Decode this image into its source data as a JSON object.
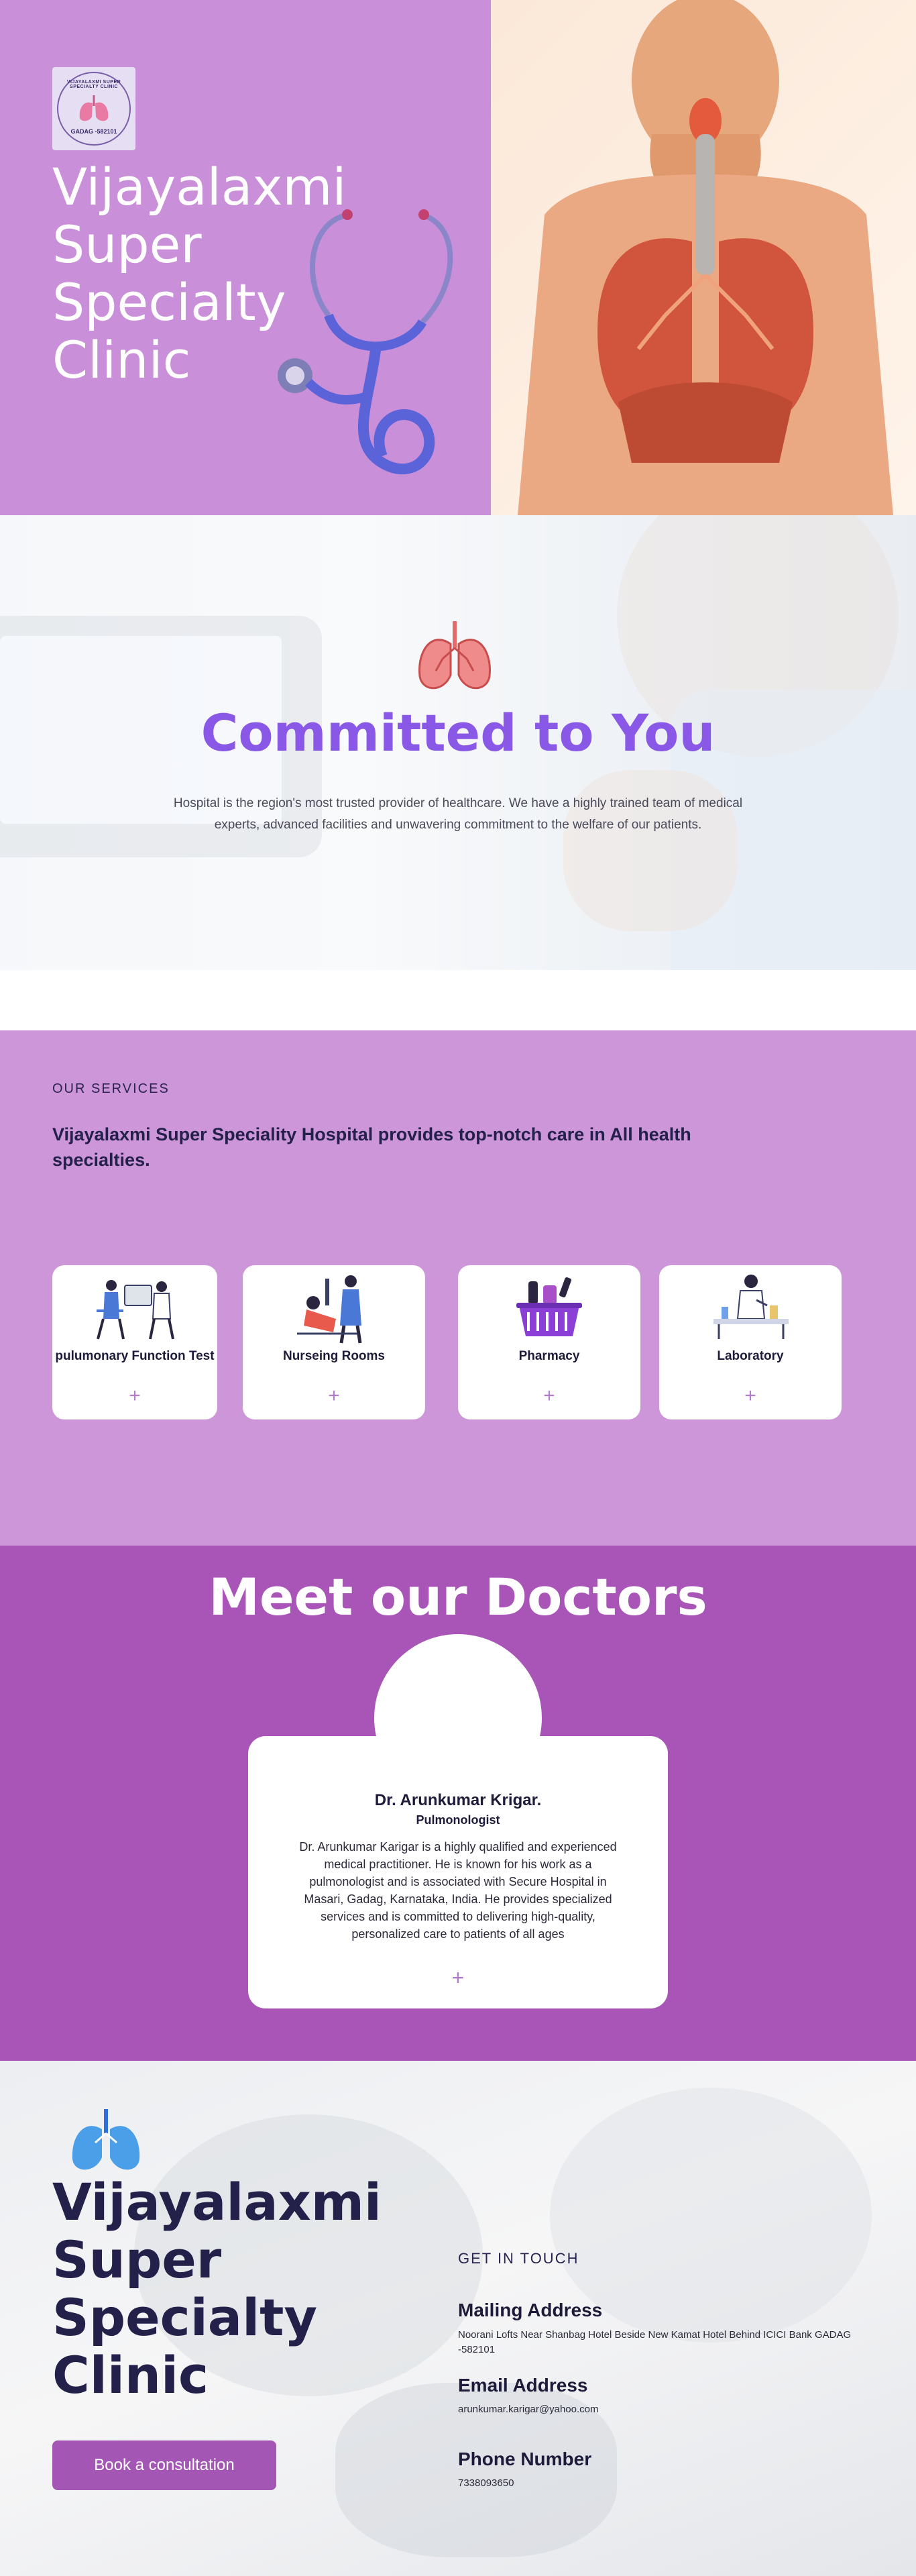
{
  "hero": {
    "logo_top_text": "VIJAYALAXMI SUPER SPECIALTY CLINIC",
    "logo_bottom_text": "GADAG -582101",
    "title": "Vijayalaxmi Super Specialty Clinic"
  },
  "committed": {
    "title": "Committed to You",
    "text": "Hospital is the region's most trusted provider of  healthcare. We have a highly trained team of medical experts, advanced facilities and unwavering commitment to the welfare of our patients."
  },
  "services": {
    "eyebrow": "OUR SERVICES",
    "heading": "Vijayalaxmi Super Speciality Hospital provides top-notch care in All health specialties.",
    "items": [
      {
        "label": "pulumonary Function Test",
        "plus": "+"
      },
      {
        "label": "Nurseing Rooms",
        "plus": "+"
      },
      {
        "label": "Pharmacy",
        "plus": "+"
      },
      {
        "label": "Laboratory",
        "plus": "+"
      }
    ]
  },
  "doctors": {
    "title": "Meet our Doctors",
    "name": "Dr. Arunkumar Krigar.",
    "role": "Pulmonologist",
    "bio": "Dr. Arunkumar Karigar is a highly qualified and experienced medical practitioner. He is known for his work as a pulmonologist and is associated with Secure Hospital in Masari, Gadag, Karnataka, India. He provides specialized services and is committed to delivering high-quality, personalized care to patients of all ages",
    "plus": "+"
  },
  "footer": {
    "title": "Vijayalaxmi Super Specialty Clinic",
    "book_label": "Book a consultation",
    "eyebrow": "GET IN TOUCH",
    "mailing_label": "Mailing Address",
    "mailing_value": "Noorani Lofts Near Shanbag Hotel Beside New Kamat Hotel Behind ICICI Bank  GADAG -582101",
    "email_label": "Email Address",
    "email_value": "arunkumar.karigar@yahoo.com",
    "phone_label": "Phone Number",
    "phone_value": "7338093650"
  },
  "colors": {
    "hero_purple": "#c98fd8",
    "services_purple": "#cd96d9",
    "doctors_purple": "#a855b7",
    "title_violet": "#8a58e6",
    "button": "#a456b4"
  }
}
